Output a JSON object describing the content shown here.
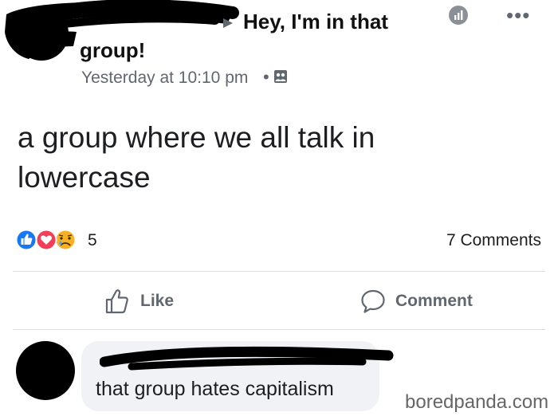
{
  "post": {
    "group_name_line1": "Hey, I'm in that",
    "group_name_line2": "group!",
    "timestamp": "Yesterday at 10:10 pm",
    "separator": "•",
    "body": "a group where we all talk in lowercase"
  },
  "icons": {
    "audience": "group-audience-icon",
    "stats": "insights-icon",
    "more": "more-options-icon"
  },
  "more_glyph": "•••",
  "reactions": {
    "types": [
      "like",
      "love",
      "sad"
    ],
    "count": "5",
    "comments_label": "7 Comments"
  },
  "actions": {
    "like_label": "Like",
    "comment_label": "Comment"
  },
  "comment": {
    "text": "that group hates capitalism"
  },
  "watermark": "boredpanda.com",
  "colors": {
    "like_blue": "#1877f2",
    "love_red": "#f33e58",
    "sad_yellow": "#f7b125",
    "secondary_text": "#606770",
    "bubble_bg": "#f0f2f5"
  }
}
